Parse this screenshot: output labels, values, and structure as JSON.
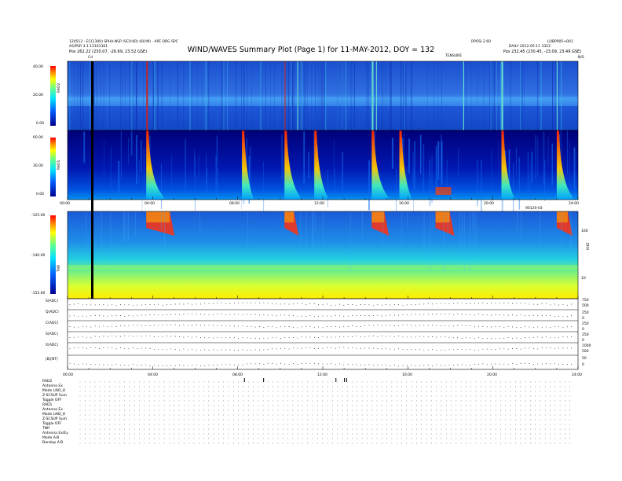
{
  "title": "WIND/WAVES Summary Plot (Page 1) for 11-MAY-2012, DOY = 132",
  "header": {
    "left_line1": "120512 - ECC(300) SPHA-NSP (SC0:60) (60:M) - APE ORG SPC",
    "left_line2": "AS/PSR 3.1  12101301",
    "left_pos": "Pos   262.22 (230.07, -26.69, 23.52 GSE)",
    "left_cd": "Cd",
    "right_top1": "RPOSI 2.60",
    "right_top2": "LOBP005+001",
    "right_mid1": "DAILY 2012-05-11 3323",
    "right_tensure": "TENSURE",
    "right_pos": "Pos   232.45 (230.45, -23.09, 23.49 GSE)",
    "right_edge": "N/S"
  },
  "chart_data": [
    {
      "type": "heatmap",
      "panel": "RAD2",
      "ylabel": "RAD2",
      "yticks": [
        "40.00",
        "20.00",
        "0.00"
      ],
      "ylim": [
        0,
        40
      ],
      "colorbar": true
    },
    {
      "type": "heatmap",
      "panel": "RAD1",
      "ylabel": "RAD1",
      "yticks": [
        "60.00",
        "30.00",
        "0.00"
      ],
      "ylim": [
        0,
        60
      ],
      "colorbar": true
    },
    {
      "type": "heatmap",
      "panel": "TNR",
      "ylabel": "TNR",
      "yticks": [
        "-125.00",
        "-140.00",
        "-155.00"
      ],
      "ylim": [
        -155,
        -125
      ],
      "right_ticks": [
        "100",
        "10"
      ],
      "right_label": "KHZ"
    },
    {
      "type": "line",
      "panel": "housekeeping",
      "rows": [
        {
          "name": "S(ADC)",
          "right": [
            "750",
            "500"
          ]
        },
        {
          "name": "Q(ADC)",
          "right": [
            "250",
            "0"
          ]
        },
        {
          "name": "C(ADC)",
          "right": [
            "250",
            "0"
          ]
        },
        {
          "name": "S(ADC)",
          "right": [
            "250",
            "0"
          ]
        },
        {
          "name": "X(ADC)",
          "right": [
            "1000",
            "500"
          ]
        },
        {
          "name": "|B|(NT)",
          "right": [
            "50",
            "0"
          ]
        }
      ]
    }
  ],
  "time_axis": {
    "ticks_top": [
      "00:00",
      "04:00",
      "08:00",
      "12:00",
      "16:00",
      "20:00",
      "24:00"
    ],
    "ticks_bottom": [
      "00:00",
      "04:00",
      "08:00",
      "12:00",
      "16:00",
      "20:00",
      "24:00"
    ],
    "tnr_label": "90120-03"
  },
  "status_table": {
    "rad2_header": "RAD2",
    "rad2_rows": [
      "Antenna   Ex",
      "Mode    LIN1_8",
      "Z-SCSUP  Sum",
      "Toggle   OFF"
    ],
    "rad1_header": "RAD1",
    "rad1_rows": [
      "Antenna   Ex",
      "Mode  LIN2_8",
      "Z-SCSUP Sum",
      "Toggle   OFF"
    ],
    "tnr_header": "TNR",
    "tnr_rows": [
      "Antenna  Ex/Ey",
      "Mode    A-B",
      "Bandup   A-B"
    ]
  },
  "colors": {
    "low": "#00008f",
    "mid": "#00c0ff",
    "high": "#ffff00",
    "peak": "#ff2000"
  }
}
